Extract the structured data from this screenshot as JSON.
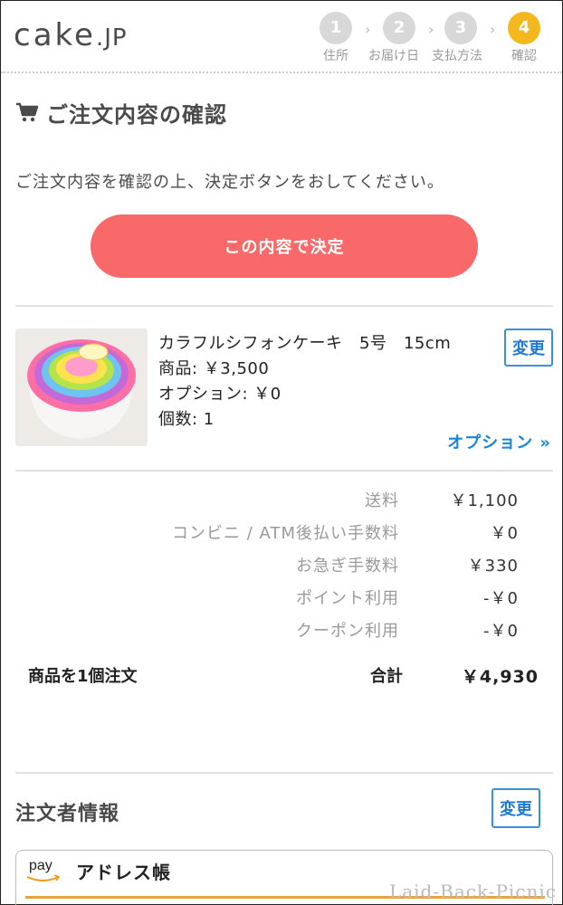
{
  "header": {
    "logo_main": "cake",
    "logo_sub": ".JP",
    "steps": [
      {
        "num": "1",
        "label": "住所"
      },
      {
        "num": "2",
        "label": "お届け日"
      },
      {
        "num": "3",
        "label": "支払方法"
      },
      {
        "num": "4",
        "label": "確認"
      }
    ],
    "active_step": 4
  },
  "page_title": "ご注文内容の確認",
  "instruction": "ご注文内容を確認の上、決定ボタンをおしてください。",
  "decide_button": "この内容で決定",
  "product": {
    "name": "カラフルシフォンケーキ　5号　15cm",
    "price": "商品: ￥3,500",
    "option": "オプション: ￥0",
    "quantity": "個数: 1",
    "change_label": "変更",
    "option_link": "オプション »"
  },
  "summary": {
    "rows": [
      {
        "label": "送料",
        "value": "￥1,100"
      },
      {
        "label": "コンビニ / ATM後払い手数料",
        "value": "￥0"
      },
      {
        "label": "お急ぎ手数料",
        "value": "￥330"
      },
      {
        "label": "ポイント利用",
        "value": "-￥0"
      },
      {
        "label": "クーポン利用",
        "value": "-￥0"
      }
    ],
    "item_count": "商品を1個注文",
    "total_label": "合計",
    "total_value": "￥4,930"
  },
  "orderer": {
    "title": "注文者情報",
    "change_label": "変更"
  },
  "amazon_pay": {
    "logo": "pay",
    "title": "アドレス帳"
  },
  "watermark": "Laid-Back-Picnic",
  "colors": {
    "accent_button": "#f96969",
    "active_step": "#f4b81f",
    "link_blue": "#1a84d8"
  }
}
